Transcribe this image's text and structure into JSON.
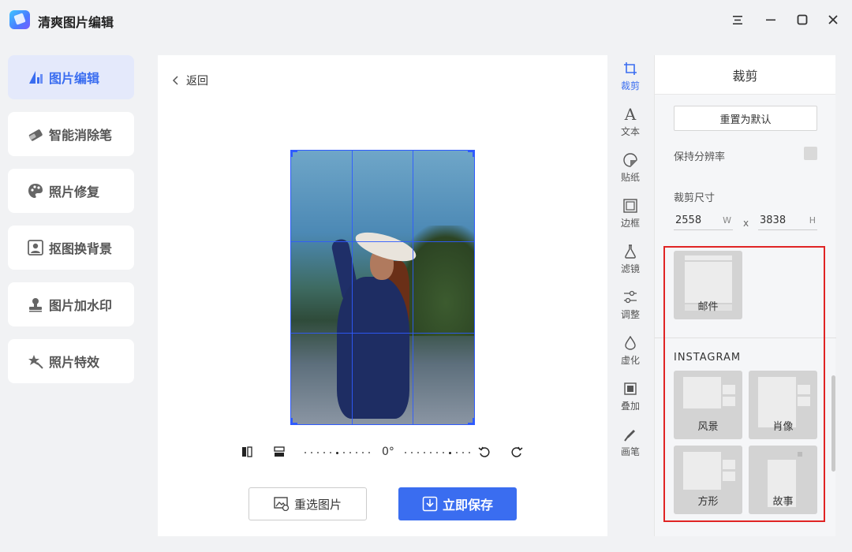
{
  "app": {
    "title": "清爽图片编辑",
    "icons": {
      "logo": "app-logo-icon",
      "menu": "menu-icon",
      "minimize": "minimize-icon",
      "maximize": "maximize-icon",
      "close": "close-icon"
    }
  },
  "sidebar": {
    "items": [
      {
        "label": "图片编辑",
        "icon": "edit-ruler-icon",
        "active": true
      },
      {
        "label": "智能消除笔",
        "icon": "eraser-icon",
        "active": false
      },
      {
        "label": "照片修复",
        "icon": "palette-icon",
        "active": false
      },
      {
        "label": "抠图换背景",
        "icon": "portrait-icon",
        "active": false
      },
      {
        "label": "图片加水印",
        "icon": "stamp-icon",
        "active": false
      },
      {
        "label": "照片特效",
        "icon": "magic-star-icon",
        "active": false
      }
    ]
  },
  "canvas": {
    "back_label": "返回",
    "rotation_value": "0°",
    "reselect_label": "重选图片",
    "save_label": "立即保存"
  },
  "tools": [
    {
      "label": "裁剪",
      "icon": "crop-icon",
      "active": true
    },
    {
      "label": "文本",
      "icon": "text-icon",
      "active": false
    },
    {
      "label": "贴纸",
      "icon": "sticker-icon",
      "active": false
    },
    {
      "label": "边框",
      "icon": "frame-icon",
      "active": false
    },
    {
      "label": "滤镜",
      "icon": "filter-flask-icon",
      "active": false
    },
    {
      "label": "调整",
      "icon": "adjust-sliders-icon",
      "active": false
    },
    {
      "label": "虚化",
      "icon": "blur-drop-icon",
      "active": false
    },
    {
      "label": "叠加",
      "icon": "overlay-icon",
      "active": false
    },
    {
      "label": "画笔",
      "icon": "brush-icon",
      "active": false
    }
  ],
  "panel": {
    "title": "裁剪",
    "reset_label": "重置为默认",
    "keep_resolution_label": "保持分辨率",
    "crop_size_label": "裁剪尺寸",
    "width_value": "2558",
    "width_unit": "W",
    "separator": "x",
    "height_value": "3838",
    "height_unit": "H",
    "mail_preset_label": "邮件",
    "instagram_title": "INSTAGRAM",
    "instagram_presets": [
      "风景",
      "肖像",
      "方形",
      "故事"
    ]
  },
  "colors": {
    "accent": "#3a6df0",
    "highlight": "#e02424",
    "grid": "#2f5bff"
  }
}
